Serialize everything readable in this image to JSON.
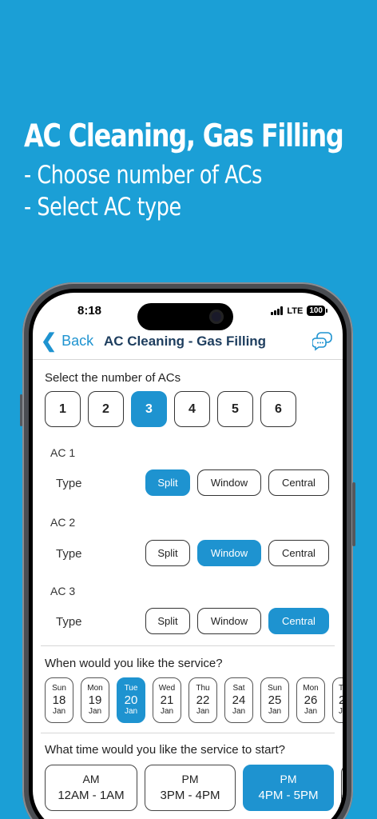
{
  "promo": {
    "title": "AC Cleaning, Gas Filling",
    "lines": [
      "- Choose number of ACs",
      "- Select AC type"
    ]
  },
  "status_bar": {
    "time": "8:18",
    "network": "LTE",
    "battery": "100"
  },
  "nav": {
    "back_label": "Back",
    "title": "AC Cleaning - Gas Filling",
    "chat_icon": "chat-bubbles-icon"
  },
  "ac_count": {
    "label": "Select the number of ACs",
    "options": [
      "1",
      "2",
      "3",
      "4",
      "5",
      "6"
    ],
    "selected": "3"
  },
  "type_label": "Type",
  "type_options": [
    "Split",
    "Window",
    "Central"
  ],
  "acs": [
    {
      "label": "AC 1",
      "selected": "Split"
    },
    {
      "label": "AC 2",
      "selected": "Window"
    },
    {
      "label": "AC 3",
      "selected": "Central"
    }
  ],
  "date_section": {
    "label": "When would you like the service?",
    "dates": [
      {
        "dow": "Sun",
        "day": "18",
        "month": "Jan"
      },
      {
        "dow": "Mon",
        "day": "19",
        "month": "Jan"
      },
      {
        "dow": "Tue",
        "day": "20",
        "month": "Jan",
        "selected": true
      },
      {
        "dow": "Wed",
        "day": "21",
        "month": "Jan"
      },
      {
        "dow": "Thu",
        "day": "22",
        "month": "Jan"
      },
      {
        "dow": "Sat",
        "day": "24",
        "month": "Jan"
      },
      {
        "dow": "Sun",
        "day": "25",
        "month": "Jan"
      },
      {
        "dow": "Mon",
        "day": "26",
        "month": "Jan"
      },
      {
        "dow": "T",
        "day": "2",
        "month": "J"
      }
    ]
  },
  "time_section": {
    "label": "What time would you like the service to start?",
    "slots": [
      {
        "period": "AM",
        "range": "12AM - 1AM"
      },
      {
        "period": "PM",
        "range": "3PM - 4PM"
      },
      {
        "period": "PM",
        "range": "4PM - 5PM",
        "selected": true
      }
    ]
  },
  "colors": {
    "background": "#1b9fd6",
    "accent": "#1e93d0",
    "title": "#1d3d5e"
  }
}
